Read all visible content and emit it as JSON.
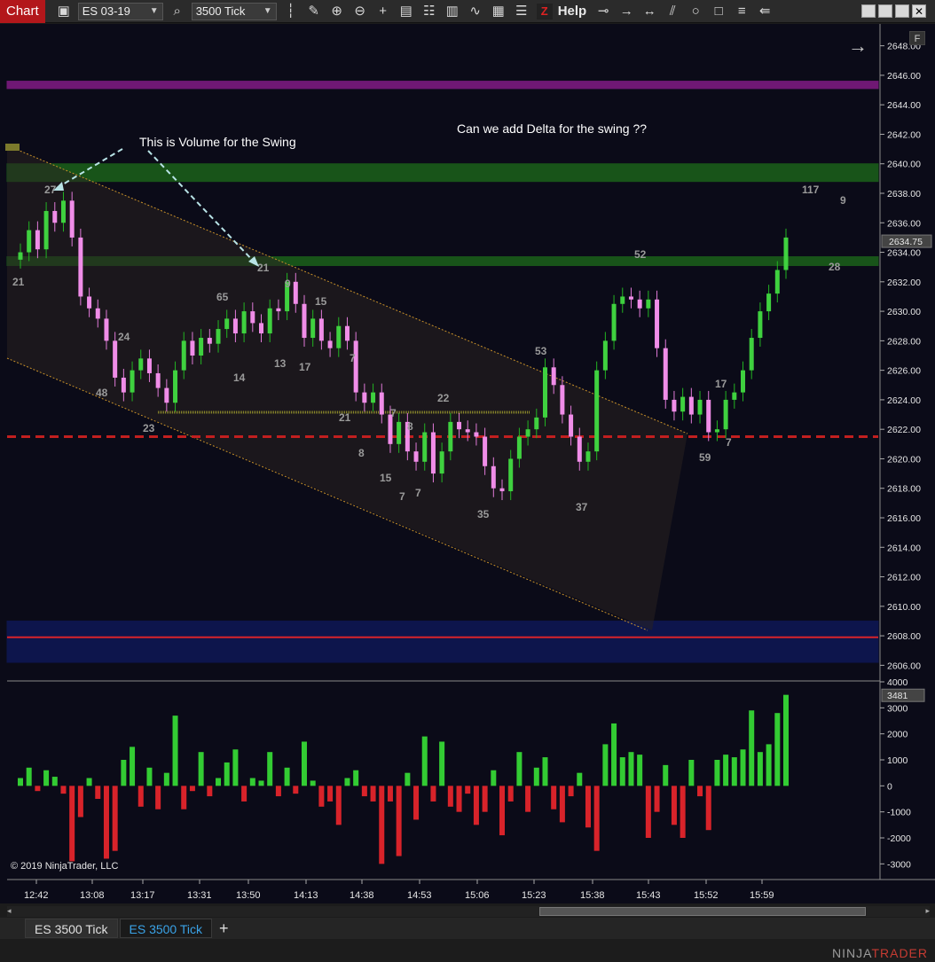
{
  "toolbar": {
    "chart_label": "Chart",
    "instrument": "ES 03-19",
    "interval": "3500 Tick",
    "help_label": "Help",
    "icons": [
      "camera-icon",
      "search-icon",
      "bars-icon",
      "pencil-icon",
      "zoom-in-icon",
      "zoom-out-icon",
      "crosshair-icon",
      "properties-icon",
      "strategies-icon",
      "indicators-icon",
      "chart-trader-icon",
      "data-box-icon",
      "chart-style-icon",
      "z-icon",
      "line-icon",
      "ray-icon",
      "extended-line-icon",
      "channel-icon",
      "ellipse-icon",
      "rectangle-icon",
      "fibonacci-icon",
      "other-tools-icon"
    ],
    "window_buttons": [
      "minimize",
      "maximize",
      "restore",
      "close"
    ]
  },
  "panel": {
    "f_button": "F",
    "copyright": "© 2019 NinjaTrader, LLC"
  },
  "annotations": [
    {
      "text": "This is Volume for the Swing"
    },
    {
      "text": "Can we add Delta for the swing ??"
    }
  ],
  "price_axis": {
    "ticks": [
      "2648.00",
      "2646.00",
      "2644.00",
      "2642.00",
      "2640.00",
      "2638.00",
      "2636.00",
      "2634.00",
      "2632.00",
      "2630.00",
      "2628.00",
      "2626.00",
      "2624.00",
      "2622.00",
      "2620.00",
      "2618.00",
      "2616.00",
      "2614.00",
      "2612.00",
      "2610.00",
      "2608.00",
      "2606.00"
    ],
    "last_price": "2634.75"
  },
  "delta_axis": {
    "ticks": [
      "4000",
      "3000",
      "2000",
      "1000",
      "0",
      "-1000",
      "-2000",
      "-3000"
    ],
    "last_value": "3481"
  },
  "time_axis": [
    "12:42",
    "13:08",
    "13:17",
    "13:31",
    "13:50",
    "14:13",
    "14:38",
    "14:53",
    "15:06",
    "15:23",
    "15:38",
    "15:43",
    "15:52",
    "15:59"
  ],
  "swing_volume_labels": [
    "21",
    "27",
    "48",
    "24",
    "23",
    "14",
    "65",
    "21",
    "9",
    "13",
    "17",
    "15",
    "7",
    "21",
    "7",
    "8",
    "8",
    "15",
    "7",
    "7",
    "22",
    "35",
    "53",
    "37",
    "52",
    "59",
    "17",
    "7",
    "117",
    "9",
    "28"
  ],
  "chart_data": {
    "type": "candlestick",
    "price_ylim": [
      2605,
      2649
    ],
    "delta_ylim": [
      -3500,
      4000
    ],
    "zones": [
      {
        "low": 2645.1,
        "high": 2645.6,
        "color": "#7a1a7f"
      },
      {
        "low": 2638.8,
        "high": 2640.0,
        "color": "#1a5c1a"
      },
      {
        "low": 2633.1,
        "high": 2633.7,
        "color": "#1a5c1a"
      },
      {
        "low": 2606.2,
        "high": 2609.0,
        "color": "#0e1752"
      }
    ],
    "lines": [
      {
        "price": 2621.5,
        "color": "#c21f1f",
        "style": "dashed"
      },
      {
        "price": 2607.9,
        "color": "#d8232a",
        "style": "solid"
      }
    ],
    "closes": [
      2634.0,
      2635.5,
      2634.2,
      2636.8,
      2636.0,
      2637.5,
      2635.0,
      2631.0,
      2630.2,
      2629.5,
      2628.0,
      2625.5,
      2624.5,
      2626.0,
      2626.8,
      2625.8,
      2624.8,
      2623.8,
      2626.0,
      2628.0,
      2627.0,
      2628.2,
      2627.8,
      2628.8,
      2629.5,
      2628.5,
      2630.0,
      2629.2,
      2628.5,
      2630.2,
      2630.0,
      2632.0,
      2630.5,
      2628.2,
      2629.5,
      2628.0,
      2627.5,
      2629.0,
      2628.0,
      2624.5,
      2623.8,
      2624.5,
      2623.0,
      2621.0,
      2622.5,
      2620.5,
      2619.8,
      2621.8,
      2619.0,
      2620.5,
      2622.5,
      2622.0,
      2621.8,
      2621.5,
      2619.5,
      2618.0,
      2617.8,
      2620.0,
      2621.5,
      2622.0,
      2622.8,
      2626.2,
      2625.0,
      2623.0,
      2621.5,
      2619.8,
      2620.5,
      2626.0,
      2628.0,
      2630.5,
      2631.0,
      2630.8,
      2630.2,
      2630.8,
      2627.5,
      2624.0,
      2623.2,
      2624.2,
      2623.0,
      2624.0,
      2621.8,
      2622.0,
      2624.0,
      2624.5,
      2626.0,
      2628.2,
      2630.0,
      2631.2,
      2632.8,
      2635.0
    ],
    "volume_delta": [
      300,
      700,
      -200,
      600,
      350,
      -300,
      -2900,
      -1200,
      300,
      -500,
      -2800,
      -2500,
      1000,
      1500,
      -800,
      700,
      -900,
      500,
      2700,
      -900,
      -200,
      1300,
      -400,
      300,
      900,
      1400,
      -600,
      300,
      200,
      1300,
      -400,
      700,
      -300,
      1700,
      200,
      -800,
      -600,
      -1500,
      300,
      600,
      -400,
      -600,
      -3000,
      -600,
      -2700,
      500,
      -1300,
      1900,
      -600,
      1700,
      -800,
      -1000,
      -300,
      -1500,
      -1000,
      600,
      -1900,
      -600,
      1300,
      -1000,
      700,
      1100,
      -900,
      -1400,
      -400,
      500,
      -1600,
      -2500,
      1600,
      2400,
      1100,
      1300,
      1200,
      -2000,
      -1000,
      800,
      -1500,
      -2000,
      1000,
      -400,
      -1700,
      1000,
      1200,
      1100,
      1400,
      2900,
      1300,
      1600,
      2800,
      3500
    ]
  }
}
